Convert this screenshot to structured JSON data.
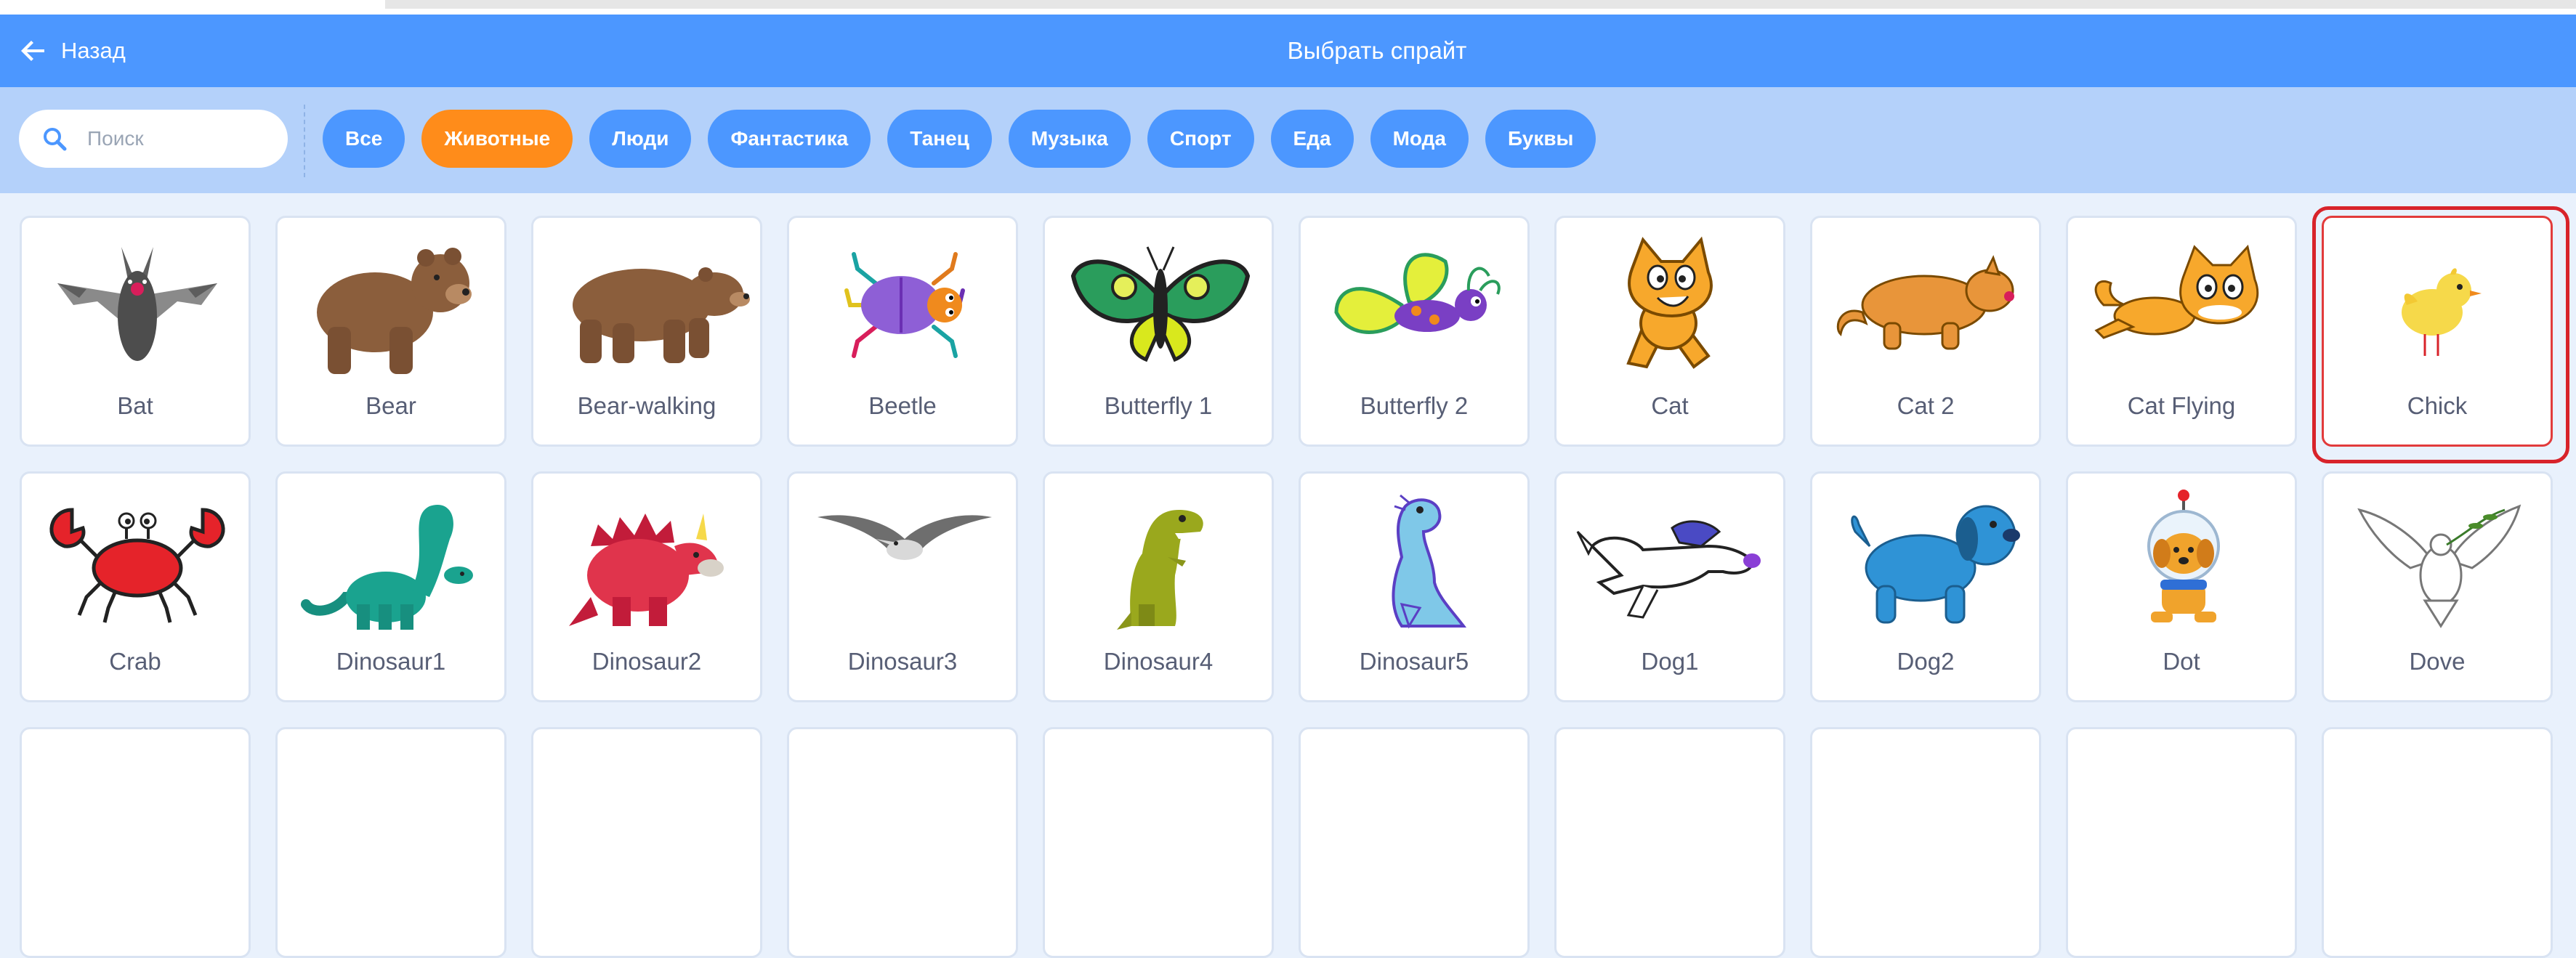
{
  "header": {
    "back_label": "Назад",
    "title": "Выбрать спрайт"
  },
  "search": {
    "placeholder": "Поиск"
  },
  "tags": [
    "Все",
    "Животные",
    "Люди",
    "Фантастика",
    "Танец",
    "Музыка",
    "Спорт",
    "Еда",
    "Мода",
    "Буквы"
  ],
  "active_tag": "Животные",
  "sprites": [
    [
      "Bat",
      "Bear",
      "Bear-walking",
      "Beetle",
      "Butterfly 1",
      "Butterfly 2",
      "Cat",
      "Cat 2",
      "Cat Flying",
      "Chick"
    ],
    [
      "Crab",
      "Dinosaur1",
      "Dinosaur2",
      "Dinosaur3",
      "Dinosaur4",
      "Dinosaur5",
      "Dog1",
      "Dog2",
      "Dot",
      "Dove"
    ]
  ],
  "selected_sprite": "Chick",
  "colors": {
    "accent": "#4c97ff",
    "active_tag": "#ff8c1a",
    "selection": "#d8232a",
    "filter_bar": "#b4d1fa"
  }
}
